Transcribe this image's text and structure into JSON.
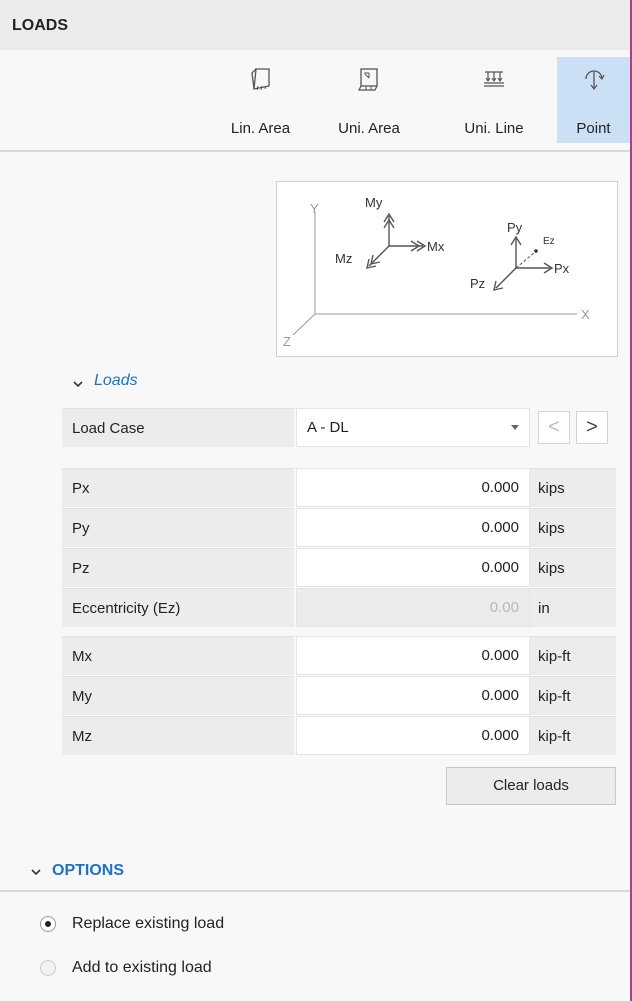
{
  "panel": {
    "title": "LOADS"
  },
  "toolbar": {
    "buttons": [
      {
        "label": "Lin. Area",
        "icon": "linear-area-load-icon",
        "active": false
      },
      {
        "label": "Uni. Area",
        "icon": "uniform-area-load-icon",
        "active": false
      },
      {
        "label": "Uni. Line",
        "icon": "uniform-line-load-icon",
        "active": false
      },
      {
        "label": "Point",
        "icon": "point-load-icon",
        "active": true
      }
    ]
  },
  "diagram": {
    "axes": {
      "y": "Y",
      "x": "X",
      "z": "Z"
    },
    "moments": {
      "my": "My",
      "mx": "Mx",
      "mz": "Mz"
    },
    "forces": {
      "py": "Py",
      "px": "Px",
      "pz": "Pz",
      "ez": "Ez"
    }
  },
  "loads_section": {
    "title": "Loads",
    "load_case": {
      "label": "Load Case",
      "value": "A - DL",
      "prev": "<",
      "next": ">"
    },
    "forces": [
      {
        "label": "Px",
        "value": "0.000",
        "unit": "kips",
        "enabled": true
      },
      {
        "label": "Py",
        "value": "0.000",
        "unit": "kips",
        "enabled": true
      },
      {
        "label": "Pz",
        "value": "0.000",
        "unit": "kips",
        "enabled": true
      },
      {
        "label": "Eccentricity (Ez)",
        "value": "0.00",
        "unit": "in",
        "enabled": false
      }
    ],
    "moments": [
      {
        "label": "Mx",
        "value": "0.000",
        "unit": "kip-ft"
      },
      {
        "label": "My",
        "value": "0.000",
        "unit": "kip-ft"
      },
      {
        "label": "Mz",
        "value": "0.000",
        "unit": "kip-ft"
      }
    ],
    "clear_button": "Clear loads"
  },
  "options": {
    "title": "OPTIONS",
    "radios": [
      {
        "label": "Replace existing load",
        "checked": true
      },
      {
        "label": "Add to existing load",
        "checked": false
      }
    ]
  },
  "colors": {
    "accent": "#1a73c8",
    "active_tab": "#cce0f5",
    "panel_border": "#b03a93"
  }
}
